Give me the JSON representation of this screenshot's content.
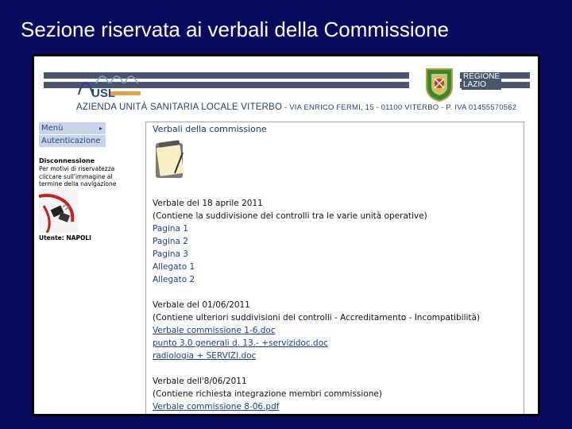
{
  "slide_title": "Sezione riservata ai verbali della Commissione",
  "header": {
    "logo_text": "USL",
    "region_line1": "REGIONE",
    "region_line2": "LAZIO",
    "agency_name": "AZIENDA UNITÀ SANITARIA LOCALE VITERBO",
    "agency_address": " - VIA ENRICO FERMI, 15 - 01100 VITERBO - P. IVA 01455570562"
  },
  "sidebar": {
    "menu": [
      {
        "label": "Menù",
        "arrow": "▸"
      },
      {
        "label": "Autenticazione"
      }
    ],
    "disconnect_title": "Disconnessione",
    "disconnect_note": "Per motivi di riservatezza cliccare sull'immagine al termine della navigazione",
    "user_label": "Utente: NAPOLI"
  },
  "content": {
    "title": "Verbali della commissione",
    "sections": [
      {
        "heading": "Verbale del 18 aprile 2011",
        "desc": "(Contiene la suddivisione dei controlli tra le varie unità operative)",
        "links": [
          "Pagina 1",
          "Pagina 2",
          "Pagina 3",
          "Allegato 1",
          "Allegato 2"
        ]
      },
      {
        "heading": "Verbale del 01/06/2011",
        "desc": "(Contiene ulteriori suddivisioni dei controlli - Accreditamento - Incompatibilità)",
        "links": [
          "Verbale commissione 1-6.doc",
          "punto 3.0 generali d. 13.- +servizidoc.doc",
          "radiologia + SERVIZI.doc"
        ]
      },
      {
        "heading": "Verbale dell'8/06/2011",
        "desc": "(Contiene richiesta integrazione membri commissione)",
        "links": [
          "Verbale commissione 8-06.pdf"
        ]
      }
    ]
  }
}
